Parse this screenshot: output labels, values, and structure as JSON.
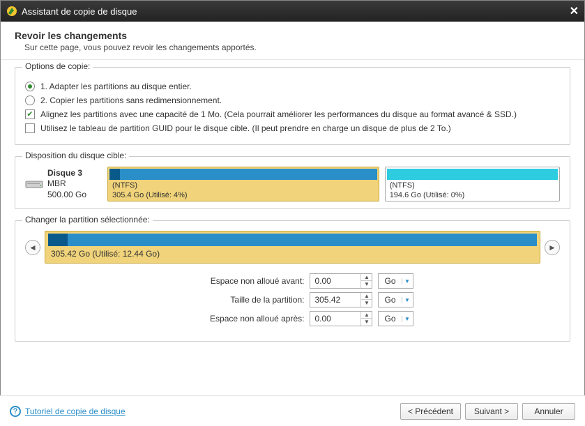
{
  "window": {
    "title": "Assistant de copie de disque"
  },
  "header": {
    "title": "Revoir les changements",
    "subtitle": "Sur cette page, vous pouvez revoir les changements apportés."
  },
  "copy_options": {
    "legend": "Options de copie:",
    "opt1": "1. Adapter les partitions au disque entier.",
    "opt2": "2. Copier les partitions sans redimensionnement.",
    "chk1": "Alignez les partitions avec une capacité de 1 Mo. (Cela pourrait améliorer les performances du disque au format avancé & SSD.)",
    "chk2": "Utilisez le tableau de partition GUID pour le disque cible. (Il peut prendre en charge un disque de plus de 2 To.)"
  },
  "target_layout": {
    "legend": "Disposition du disque cible:",
    "disk": {
      "name": "Disque 3",
      "scheme": "MBR",
      "size": "500.00 Go"
    },
    "partitions": [
      {
        "fs": "(NTFS)",
        "detail": "305.4 Go (Utilisé: 4%)",
        "used_pct": 4,
        "width_pct": 61,
        "selected": true
      },
      {
        "fs": "(NTFS)",
        "detail": "194.6 Go (Utilisé: 0%)",
        "used_pct": 0,
        "width_pct": 39,
        "selected": false
      }
    ]
  },
  "selected_partition": {
    "legend": "Changer la partition sélectionnée:",
    "summary": "305.42 Go (Utilisé: 12.44 Go)",
    "used_pct": 4
  },
  "form": {
    "before_label": "Espace non alloué avant:",
    "before_value": "0.00",
    "size_label": "Taille de la partition:",
    "size_value": "305.42",
    "after_label": "Espace non alloué après:",
    "after_value": "0.00",
    "unit": "Go"
  },
  "footer": {
    "help_text": "Tutoriel de copie de disque",
    "back": "< Précédent",
    "next": "Suivant >",
    "cancel": "Annuler"
  }
}
